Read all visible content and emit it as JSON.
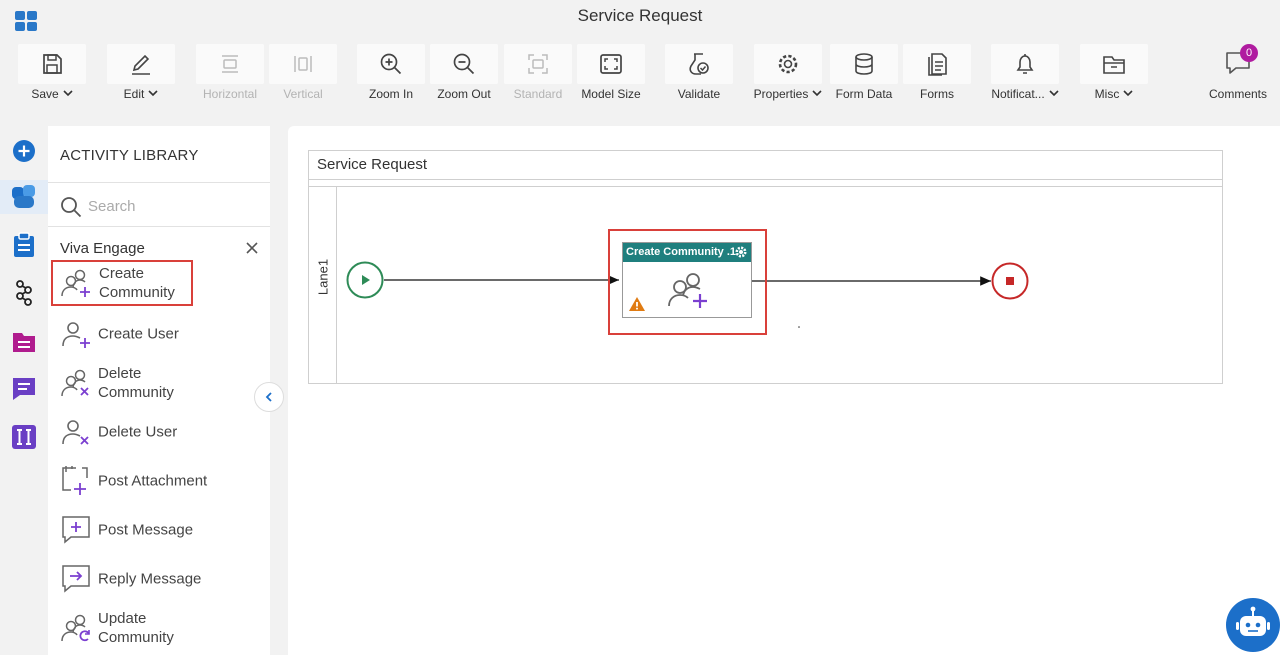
{
  "header": {
    "title": "Service Request"
  },
  "toolbar": {
    "items": [
      {
        "label": "Save",
        "caret": true,
        "disabled": false,
        "icon": "save-icon"
      },
      {
        "label": "Edit",
        "caret": true,
        "disabled": false,
        "icon": "pencil-icon"
      },
      {
        "label": "Horizontal",
        "caret": false,
        "disabled": true,
        "icon": "horizontal-icon"
      },
      {
        "label": "Vertical",
        "caret": false,
        "disabled": true,
        "icon": "vertical-icon"
      },
      {
        "label": "Zoom In",
        "caret": false,
        "disabled": false,
        "icon": "zoom-in-icon"
      },
      {
        "label": "Zoom Out",
        "caret": false,
        "disabled": false,
        "icon": "zoom-out-icon"
      },
      {
        "label": "Standard",
        "caret": false,
        "disabled": true,
        "icon": "standard-icon"
      },
      {
        "label": "Model Size",
        "caret": false,
        "disabled": false,
        "icon": "model-size-icon"
      },
      {
        "label": "Validate",
        "caret": false,
        "disabled": false,
        "icon": "validate-icon"
      },
      {
        "label": "Properties",
        "caret": true,
        "disabled": false,
        "icon": "gear-icon"
      },
      {
        "label": "Form Data",
        "caret": false,
        "disabled": false,
        "icon": "database-icon"
      },
      {
        "label": "Forms",
        "caret": false,
        "disabled": false,
        "icon": "forms-icon"
      },
      {
        "label": "Notificat...",
        "caret": true,
        "disabled": false,
        "icon": "bell-icon"
      },
      {
        "label": "Misc",
        "caret": true,
        "disabled": false,
        "icon": "folder-icon"
      }
    ],
    "comments": {
      "label": "Comments",
      "count": "0"
    }
  },
  "rail": {
    "items": [
      "add-icon",
      "app-builder-icon",
      "clipboard-icon",
      "workflow-icon",
      "document-icon",
      "message-icon",
      "text-field-icon"
    ]
  },
  "library": {
    "title": "ACTIVITY LIBRARY",
    "search_placeholder": "Search",
    "group": "Viva Engage",
    "items": [
      {
        "label": "Create\nCommunity",
        "icon": "create-community-icon"
      },
      {
        "label": "Create User",
        "icon": "create-user-icon"
      },
      {
        "label": "Delete\nCommunity",
        "icon": "delete-community-icon"
      },
      {
        "label": "Delete User",
        "icon": "delete-user-icon"
      },
      {
        "label": "Post Attachment",
        "icon": "post-attachment-icon"
      },
      {
        "label": "Post Message",
        "icon": "post-message-icon"
      },
      {
        "label": "Reply Message",
        "icon": "reply-message-icon"
      },
      {
        "label": "Update\nCommunity",
        "icon": "update-community-icon"
      }
    ]
  },
  "canvas": {
    "pool_title": "Service Request",
    "lane": "Lane1",
    "task": {
      "title": "Create Community .1"
    }
  },
  "colors": {
    "accent": "#2a78c8",
    "task_header": "#1f7f7e",
    "highlight": "#d9403a",
    "start": "#2e8b57",
    "end": "#c62828",
    "badge": "#b01ca0"
  }
}
